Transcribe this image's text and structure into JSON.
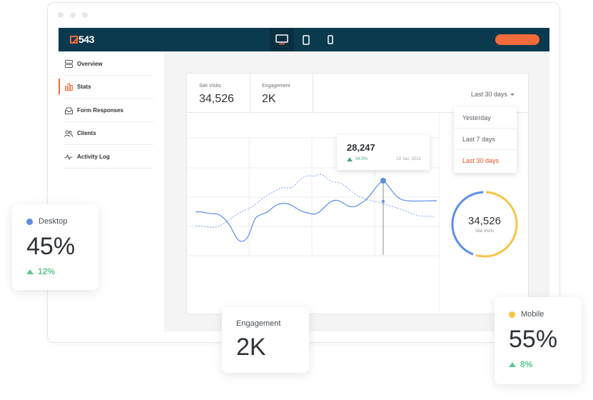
{
  "app": {
    "logo_text": "543",
    "devices": [
      {
        "name": "desktop-icon",
        "active": true
      },
      {
        "name": "tablet-icon",
        "active": false
      },
      {
        "name": "mobile-icon",
        "active": false
      }
    ]
  },
  "sidebar": {
    "items": [
      {
        "label": "Overview",
        "icon": "overview-icon"
      },
      {
        "label": "Stats",
        "icon": "bar-chart-icon",
        "active": true
      },
      {
        "label": "Form Responses",
        "icon": "inbox-icon"
      },
      {
        "label": "Clients",
        "icon": "users-icon"
      },
      {
        "label": "Activity Log",
        "icon": "activity-icon"
      }
    ]
  },
  "stats": {
    "site_visits_label": "Site Visits",
    "site_visits_value": "34,526",
    "engagement_label": "Engagement",
    "engagement_value": "2K"
  },
  "range": {
    "selected": "Last 30 days",
    "options": [
      "Yesterday",
      "Last 7 days",
      "Last 30 days"
    ]
  },
  "tooltip": {
    "value": "28,247",
    "change": "34.5%",
    "date": "19 Jan, 2021"
  },
  "donut": {
    "value": "34,526",
    "label": "Site Visits",
    "desktop_share": 0.45,
    "colors": {
      "desktop": "#5b8ee6",
      "mobile": "#f7c548"
    }
  },
  "cards": {
    "desktop": {
      "label": "Desktop",
      "percent": "45%",
      "change": "12%",
      "color": "#5b8ee6"
    },
    "engagement": {
      "label": "Engagement",
      "value": "2K"
    },
    "mobile": {
      "label": "Mobile",
      "percent": "55%",
      "change": "8%",
      "color": "#f7c548"
    }
  },
  "colors": {
    "brand": "#0b3a4f",
    "accent": "#f26b3a",
    "positive": "#45b07d"
  }
}
